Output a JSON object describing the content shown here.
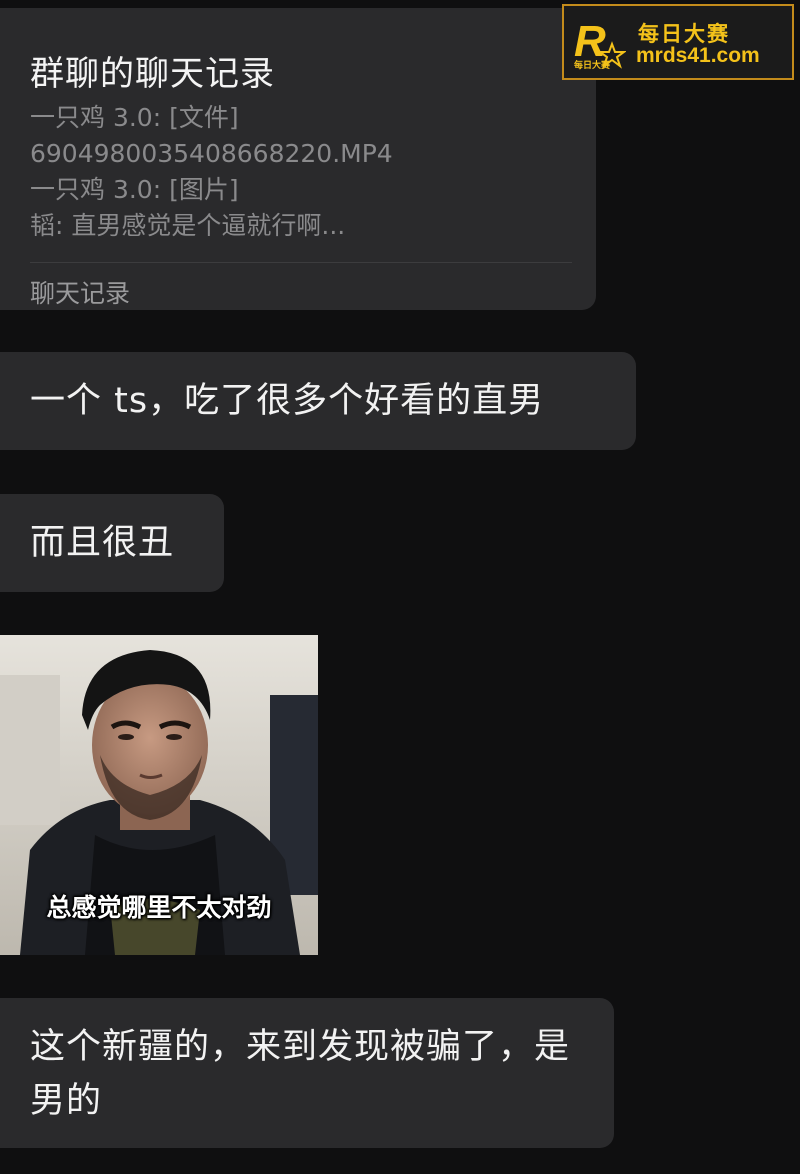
{
  "chat_record": {
    "title": "群聊的聊天记录",
    "lines": [
      "一只鸡 3.0: [文件]",
      "6904980035408668220.MP4",
      "一只鸡 3.0: [图片]",
      "韬: 直男感觉是个逼就行啊..."
    ],
    "footer": "聊天记录"
  },
  "messages": [
    {
      "text": "一个 ts，吃了很多个好看的直男"
    },
    {
      "text": "而且很丑"
    },
    {
      "sticker_caption": "总感觉哪里不太对劲"
    },
    {
      "text": "这个新疆的，来到发现被骗了，是男的"
    }
  ],
  "watermark": {
    "brand": "每日大赛",
    "url": "mrds41.com",
    "logo_letter": "R",
    "logo_small_text": "每日大赛",
    "accent": "#f4c21a"
  },
  "colors": {
    "background": "#0f0f10",
    "bubble": "#2a2a2c",
    "text": "#f2f2f2",
    "muted": "#8a8a8c"
  }
}
